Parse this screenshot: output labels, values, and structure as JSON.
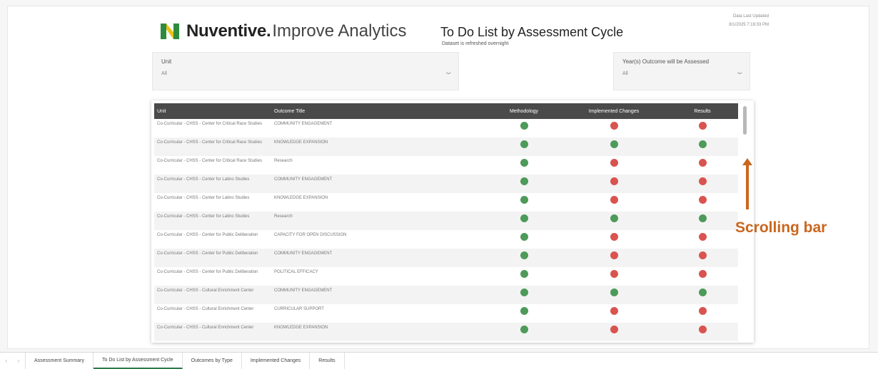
{
  "header": {
    "brand": "Nuventive.",
    "product": "Improve Analytics",
    "title": "To Do List by Assessment Cycle",
    "subtitle": "Dataset is refreshed overnight",
    "updated_label": "Data Last Updated",
    "updated_value": "8/1/2025 7:19:33 PM"
  },
  "brand_colors": {
    "logo_green": "#2e8b3d",
    "logo_yellow": "#e8c21a",
    "header_row": "#4a4a4a",
    "status_green": "#4e9a5a",
    "status_red": "#d9534f",
    "annotation": "#c9661e"
  },
  "filters": {
    "unit": {
      "label": "Unit",
      "value": "All"
    },
    "year": {
      "label": "Year(s) Outcome will be Assessed",
      "value": "All"
    }
  },
  "table": {
    "columns": [
      "Unit",
      "Outcome Title",
      "Methodology",
      "Implemented Changes",
      "Results"
    ],
    "rows": [
      {
        "unit": "Co-Curricular - CHSS - Center for Critical Race Studies",
        "outcome": "COMMUNITY ENGAGEMENT",
        "methodology": "green",
        "changes": "red",
        "results": "red"
      },
      {
        "unit": "Co-Curricular - CHSS - Center for Critical Race Studies",
        "outcome": "KNOWLEDGE EXPANSION",
        "methodology": "green",
        "changes": "green",
        "results": "green"
      },
      {
        "unit": "Co-Curricular - CHSS - Center for Critical Race Studies",
        "outcome": "Research",
        "methodology": "green",
        "changes": "red",
        "results": "red"
      },
      {
        "unit": "Co-Curricular - CHSS - Center for Latino Studies",
        "outcome": "COMMUNITY ENGAGEMENT",
        "methodology": "green",
        "changes": "red",
        "results": "red"
      },
      {
        "unit": "Co-Curricular - CHSS - Center for Latino Studies",
        "outcome": "KNOWLEDGE EXPANSION",
        "methodology": "green",
        "changes": "red",
        "results": "red"
      },
      {
        "unit": "Co-Curricular - CHSS - Center for Latino Studies",
        "outcome": "Research",
        "methodology": "green",
        "changes": "green",
        "results": "green"
      },
      {
        "unit": "Co-Curricular - CHSS - Center for Public Deliberation",
        "outcome": "CAPACITY FOR OPEN DISCUSSION",
        "methodology": "green",
        "changes": "red",
        "results": "red"
      },
      {
        "unit": "Co-Curricular - CHSS - Center for Public Deliberation",
        "outcome": "COMMUNITY ENGAGEMENT",
        "methodology": "green",
        "changes": "red",
        "results": "red"
      },
      {
        "unit": "Co-Curricular - CHSS - Center for Public Deliberation",
        "outcome": "POLITICAL EFFICACY",
        "methodology": "green",
        "changes": "red",
        "results": "red"
      },
      {
        "unit": "Co-Curricular - CHSS - Cultural Enrichment Center",
        "outcome": "COMMUNITY ENGAGEMENT",
        "methodology": "green",
        "changes": "green",
        "results": "green"
      },
      {
        "unit": "Co-Curricular - CHSS - Cultural Enrichment Center",
        "outcome": "CURRICULAR SUPPORT",
        "methodology": "green",
        "changes": "red",
        "results": "red"
      },
      {
        "unit": "Co-Curricular - CHSS - Cultural Enrichment Center",
        "outcome": "KNOWLEDGE EXPANSION",
        "methodology": "green",
        "changes": "red",
        "results": "red"
      }
    ]
  },
  "annotation": {
    "text": "Scrolling bar"
  },
  "tabs": [
    {
      "label": "Assessment Summary",
      "active": false
    },
    {
      "label": "To Do List by Assessment Cycle",
      "active": true
    },
    {
      "label": "Outcomes by Type",
      "active": false
    },
    {
      "label": "Implemented Changes",
      "active": false
    },
    {
      "label": "Results",
      "active": false
    }
  ],
  "tab_nav": {
    "prev_icon": "‹",
    "next_icon": "›"
  }
}
